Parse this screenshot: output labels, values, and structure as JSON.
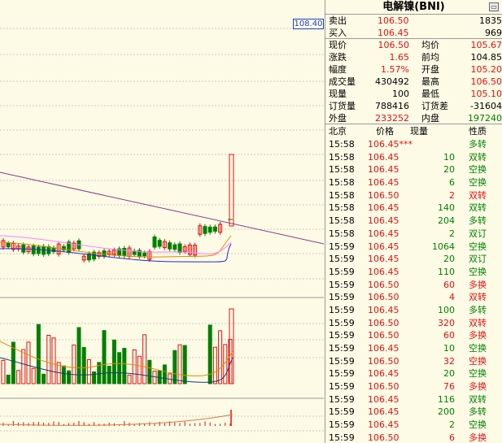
{
  "chart": {
    "price_tag": "108.40"
  },
  "quote": {
    "title": "电解镍(BNI)",
    "ask_label": "卖出",
    "ask_price": "106.50",
    "ask_vol": "1835",
    "bid_label": "买入",
    "bid_price": "106.45",
    "bid_vol": "969",
    "stats": [
      {
        "l1": "现价",
        "v1": "106.50",
        "l2": "均价",
        "v2": "105.67"
      },
      {
        "l1": "涨跌",
        "v1": "1.65",
        "l2": "前均",
        "v2": "104.85"
      },
      {
        "l1": "幅度",
        "v1": "1.57%",
        "l2": "开盘",
        "v2": "105.20"
      },
      {
        "l1": "成交量",
        "v1": "430492",
        "l2": "最高",
        "v2": "106.50"
      },
      {
        "l1": "现量",
        "v1": "100",
        "l2": "最低",
        "v2": "105.10"
      },
      {
        "l1": "订货量",
        "v1": "788416",
        "l2": "订货差",
        "v2": "-31604"
      },
      {
        "l1": "外盘",
        "v1": "233252",
        "l2": "内盘",
        "v2": "197240"
      }
    ]
  },
  "ticks_header": {
    "time": "北京",
    "price": "价格",
    "vol": "现量",
    "nature": "性质"
  },
  "ticks": [
    {
      "time": "15:58",
      "price": "106.45***",
      "vol": "",
      "nature": "多转",
      "nc": "green"
    },
    {
      "time": "15:58",
      "price": "106.45",
      "vol": "10",
      "nature": "双转",
      "nc": "green"
    },
    {
      "time": "15:58",
      "price": "106.45",
      "vol": "20",
      "nature": "空换",
      "nc": "green"
    },
    {
      "time": "15:58",
      "price": "106.45",
      "vol": "6",
      "nature": "空换",
      "nc": "green"
    },
    {
      "time": "15:58",
      "price": "106.50",
      "vol": "2",
      "nature": "双转",
      "nc": "red"
    },
    {
      "time": "15:58",
      "price": "106.45",
      "vol": "140",
      "nature": "双转",
      "nc": "green"
    },
    {
      "time": "15:58",
      "price": "106.45",
      "vol": "204",
      "nature": "多转",
      "nc": "green"
    },
    {
      "time": "15:58",
      "price": "106.45",
      "vol": "2",
      "nature": "双订",
      "nc": "green"
    },
    {
      "time": "15:59",
      "price": "106.45",
      "vol": "1064",
      "nature": "空换",
      "nc": "green"
    },
    {
      "time": "15:59",
      "price": "106.45",
      "vol": "20",
      "nature": "双订",
      "nc": "green"
    },
    {
      "time": "15:59",
      "price": "106.45",
      "vol": "110",
      "nature": "空换",
      "nc": "green"
    },
    {
      "time": "15:59",
      "price": "106.50",
      "vol": "60",
      "nature": "多换",
      "nc": "red"
    },
    {
      "time": "15:59",
      "price": "106.50",
      "vol": "4",
      "nature": "双转",
      "nc": "red"
    },
    {
      "time": "15:59",
      "price": "106.45",
      "vol": "100",
      "nature": "多转",
      "nc": "green"
    },
    {
      "time": "15:59",
      "price": "106.50",
      "vol": "320",
      "nature": "双转",
      "nc": "red"
    },
    {
      "time": "15:59",
      "price": "106.50",
      "vol": "60",
      "nature": "多换",
      "nc": "red"
    },
    {
      "time": "15:59",
      "price": "106.45",
      "vol": "10",
      "nature": "空换",
      "nc": "green"
    },
    {
      "time": "15:59",
      "price": "106.50",
      "vol": "32",
      "nature": "空换",
      "nc": "red"
    },
    {
      "time": "15:59",
      "price": "106.45",
      "vol": "20",
      "nature": "空换",
      "nc": "green"
    },
    {
      "time": "15:59",
      "price": "106.50",
      "vol": "76",
      "nature": "多换",
      "nc": "red"
    },
    {
      "time": "15:59",
      "price": "106.45",
      "vol": "116",
      "nature": "双转",
      "nc": "green"
    },
    {
      "time": "15:59",
      "price": "106.45",
      "vol": "200",
      "nature": "多转",
      "nc": "green"
    },
    {
      "time": "15:59",
      "price": "106.45",
      "vol": "2",
      "nature": "空换",
      "nc": "green"
    },
    {
      "time": "15:59",
      "price": "106.50",
      "vol": "6",
      "nature": "多换",
      "nc": "red"
    }
  ],
  "colors": {
    "up": "#e01010",
    "down": "#008000",
    "bg": "#fdfbe6",
    "grid": "#9a9a9a"
  }
}
